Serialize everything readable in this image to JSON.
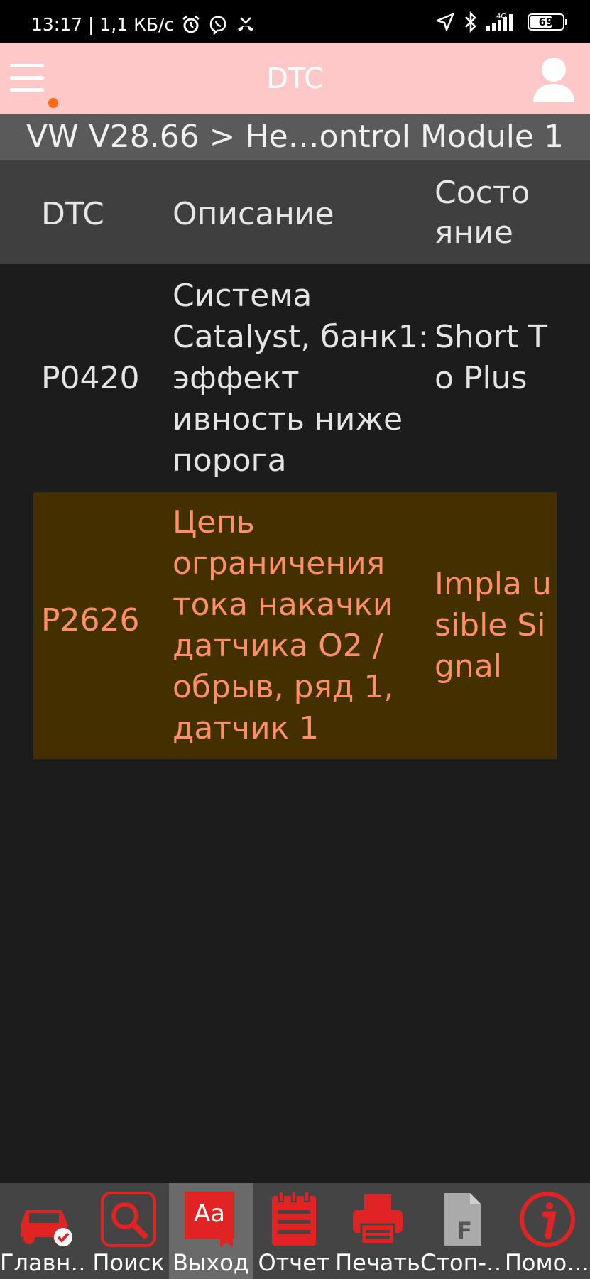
{
  "status_bar": {
    "time_info": "13:17 | 1,1 КБ/с",
    "network": "4G",
    "battery": "69",
    "battery_level": 0.69
  },
  "app_bar": {
    "title": "DTC"
  },
  "breadcrumb": "VW V28.66 > He…ontrol Module 1",
  "table": {
    "headers": [
      "DTC",
      "Описание",
      "Состо яние"
    ],
    "rows": [
      {
        "code": "P0420",
        "description": "Система Catalyst, банк1: эффект ивность ниже порога",
        "state": "Short To Plus"
      },
      {
        "code": "P2626",
        "description": "Цепь ограничения тока накачки датчика O2 / обрыв, ряд 1, датчик 1",
        "state": "Impla usible Signal"
      }
    ]
  },
  "toolbar": {
    "items": [
      {
        "label": "Главн…",
        "icon": "car-check-icon"
      },
      {
        "label": "Поиск",
        "icon": "search-icon"
      },
      {
        "label": "Выход",
        "icon": "font-size-icon"
      },
      {
        "label": "Отчет",
        "icon": "notepad-icon"
      },
      {
        "label": "Печать",
        "icon": "printer-icon"
      },
      {
        "label": "Стоп-…",
        "icon": "document-f-icon"
      },
      {
        "label": "Помо…",
        "icon": "info-icon"
      }
    ]
  },
  "colors": {
    "app_bar": "#ffc8c8",
    "background": "#1c1c1c",
    "highlight_row": "#433000",
    "highlight_text": "#ff8f66",
    "accent_red": "#e02424"
  }
}
